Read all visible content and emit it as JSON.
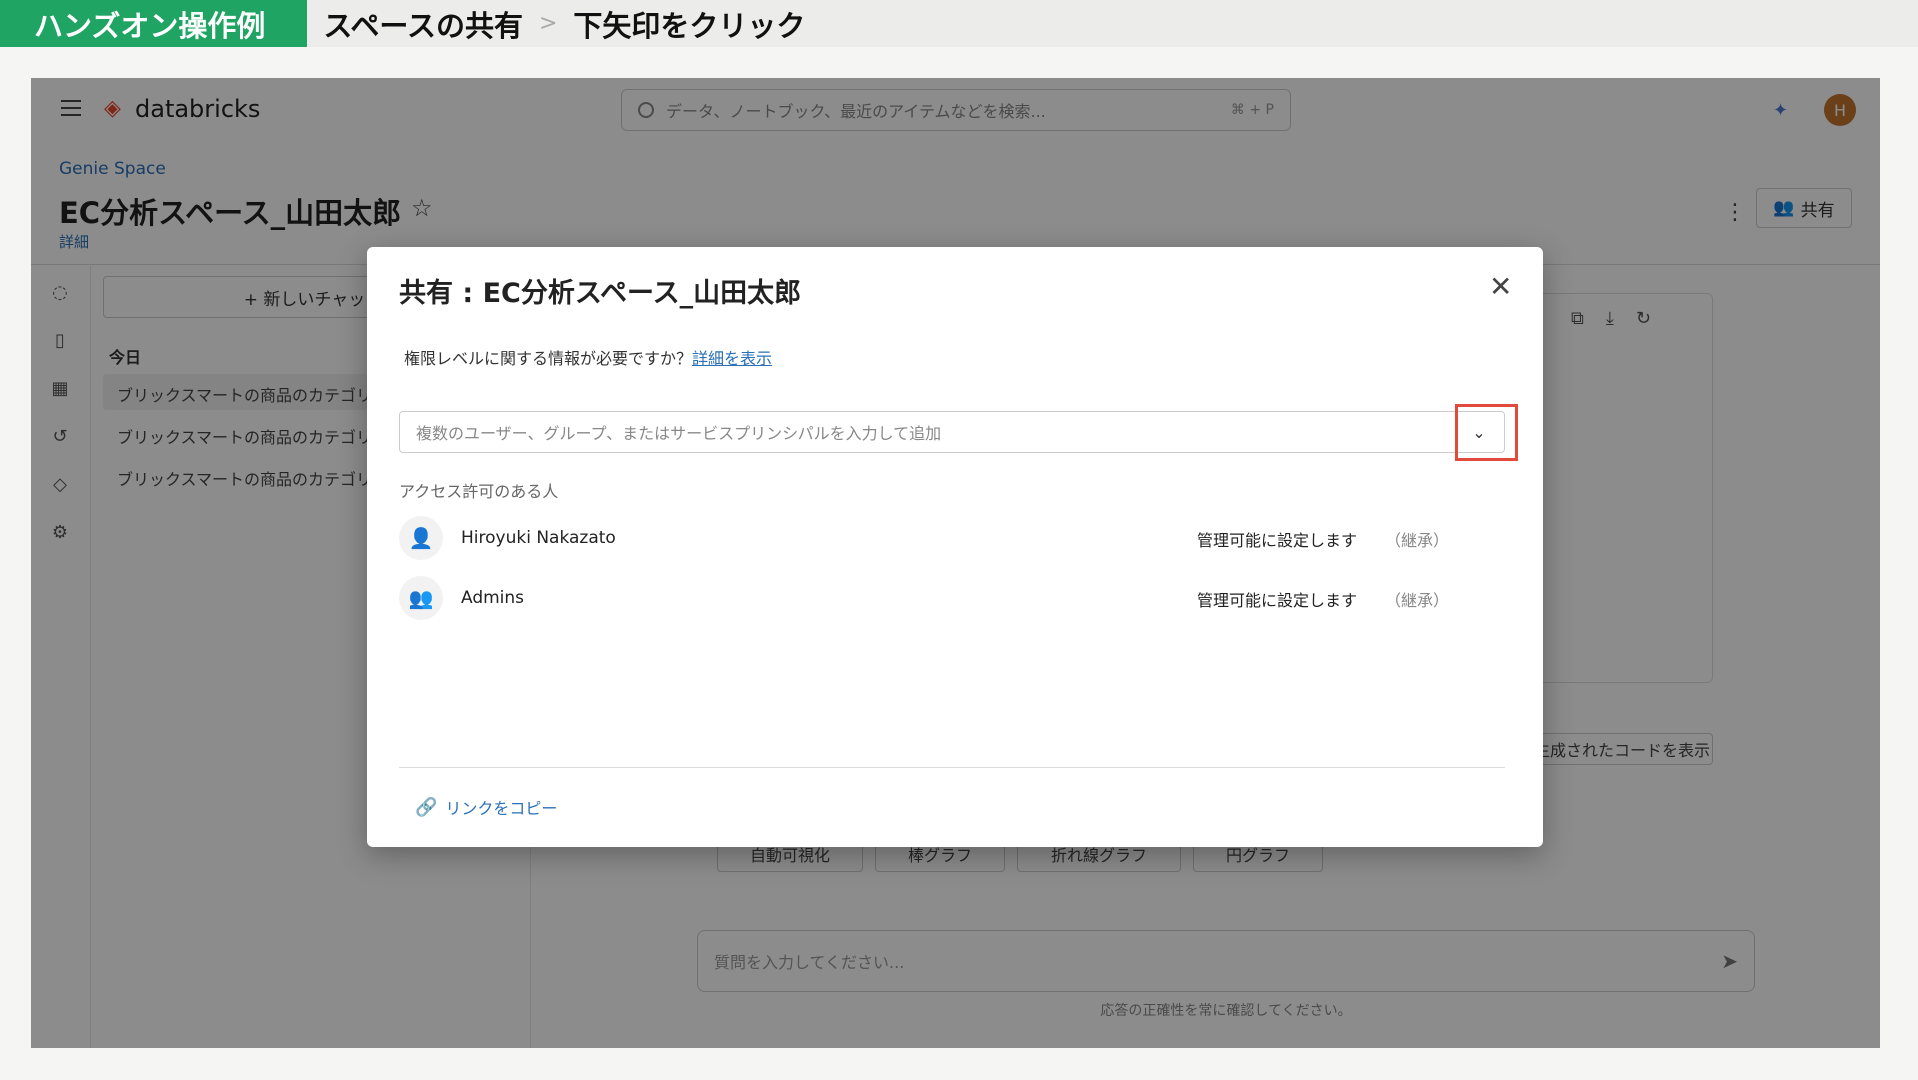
{
  "banner": {
    "tag": "ハンズオン操作例",
    "step1": "スペースの共有",
    "sep": ">",
    "step2": "下矢印をクリック"
  },
  "topbar": {
    "logo": "databricks",
    "search_placeholder": "データ、ノートブック、最近のアイテムなどを検索...",
    "search_shortcut": "⌘ + P",
    "avatar_initial": "H"
  },
  "page": {
    "breadcrumb": "Genie Space",
    "title": "EC分析スペース_山田太郎",
    "details_link": "詳細",
    "share_label": "共有"
  },
  "chat": {
    "new_chat": "+ 新しいチャット",
    "today": "今日",
    "history": [
      "ブリックスマートの商品のカテゴリ",
      "ブリックスマートの商品のカテゴリ",
      "ブリックスマートの商品のカテゴリ"
    ]
  },
  "main": {
    "show_code": "生成されたコードを表示",
    "viz_buttons": [
      "自動可視化",
      "棒グラフ",
      "折れ線グラフ",
      "円グラフ"
    ],
    "question_placeholder": "質問を入力してください...",
    "disclaimer": "応答の正確性を常に確認してください。"
  },
  "modal": {
    "title": "共有 : EC分析スペース_山田太郎",
    "info_text": "権限レベルに関する情報が必要ですか？",
    "info_link": "詳細を表示",
    "add_placeholder": "複数のユーザー、グループ、またはサービスプリンシパルを入力して追加",
    "access_heading": "アクセス許可のある人",
    "people": [
      {
        "name": "Hiroyuki Nakazato",
        "permission": "管理可能に設定します",
        "inherited": "（継承）"
      },
      {
        "name": "Admins",
        "permission": "管理可能に設定します",
        "inherited": "（継承）"
      }
    ],
    "copy_link": "リンクをコピー"
  }
}
